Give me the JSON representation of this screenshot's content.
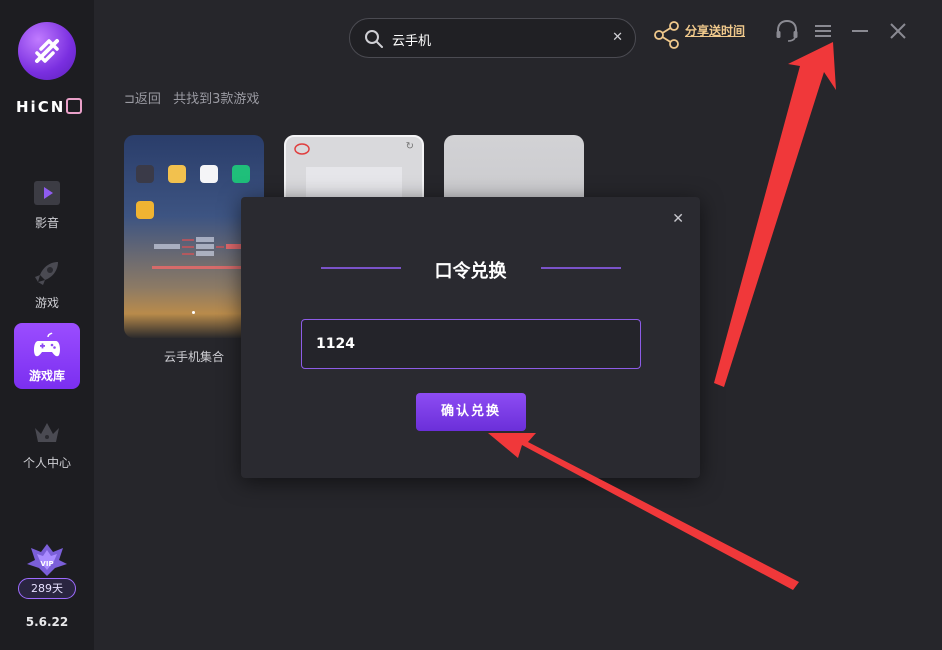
{
  "sidebar": {
    "brand": "HiCN",
    "items": [
      {
        "label": "影音",
        "icon": "play-icon"
      },
      {
        "label": "游戏",
        "icon": "rocket-icon"
      },
      {
        "label": "游戏库",
        "icon": "gamepad-icon",
        "active": true
      },
      {
        "label": "个人中心",
        "icon": "crown-icon"
      }
    ],
    "vip_badge": "VIP",
    "vip_days": "289天",
    "version": "5.6.22"
  },
  "topbar": {
    "search_value": "云手机",
    "share_label": "分享送时间"
  },
  "breadcrumb": {
    "back_label": "返回",
    "result_text": "共找到3款游戏"
  },
  "cards": [
    {
      "title": "云手机集合"
    },
    {
      "title": ""
    },
    {
      "title": ""
    }
  ],
  "modal": {
    "title": "口令兑换",
    "input_value": "1124",
    "confirm_label": "确认兑换"
  },
  "colors": {
    "accent": "#8d4cf3",
    "arrow": "#f0383a",
    "share_text": "#f0c98c"
  }
}
